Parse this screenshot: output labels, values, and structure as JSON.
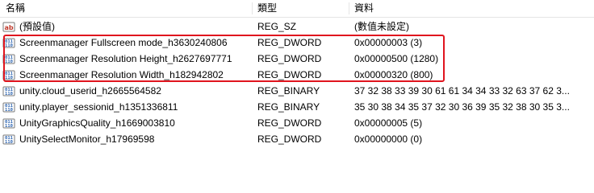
{
  "columns": {
    "name": "名稱",
    "type": "類型",
    "data": "資料"
  },
  "colors": {
    "highlight": "#e0141e",
    "sz_icon": "#c0392b",
    "bin_icon": "#2b63b0"
  },
  "rows": [
    {
      "name": "(預設值)",
      "type": "REG_SZ",
      "data": "(數值未設定)",
      "icon": "string-value-icon"
    },
    {
      "name": "Screenmanager Fullscreen mode_h3630240806",
      "type": "REG_DWORD",
      "data": "0x00000003 (3)",
      "icon": "binary-value-icon"
    },
    {
      "name": "Screenmanager Resolution Height_h2627697771",
      "type": "REG_DWORD",
      "data": "0x00000500 (1280)",
      "icon": "binary-value-icon"
    },
    {
      "name": "Screenmanager Resolution Width_h182942802",
      "type": "REG_DWORD",
      "data": "0x00000320 (800)",
      "icon": "binary-value-icon"
    },
    {
      "name": "unity.cloud_userid_h2665564582",
      "type": "REG_BINARY",
      "data": "37 32 38 33 39 30 61 61 34 34 33 32 63 37 62 3...",
      "icon": "binary-value-icon"
    },
    {
      "name": "unity.player_sessionid_h1351336811",
      "type": "REG_BINARY",
      "data": "35 30 38 34 35 37 32 30 36 39 35 32 38 30 35 3...",
      "icon": "binary-value-icon"
    },
    {
      "name": "UnityGraphicsQuality_h1669003810",
      "type": "REG_DWORD",
      "data": "0x00000005 (5)",
      "icon": "binary-value-icon"
    },
    {
      "name": "UnitySelectMonitor_h17969598",
      "type": "REG_DWORD",
      "data": "0x00000000 (0)",
      "icon": "binary-value-icon"
    }
  ]
}
